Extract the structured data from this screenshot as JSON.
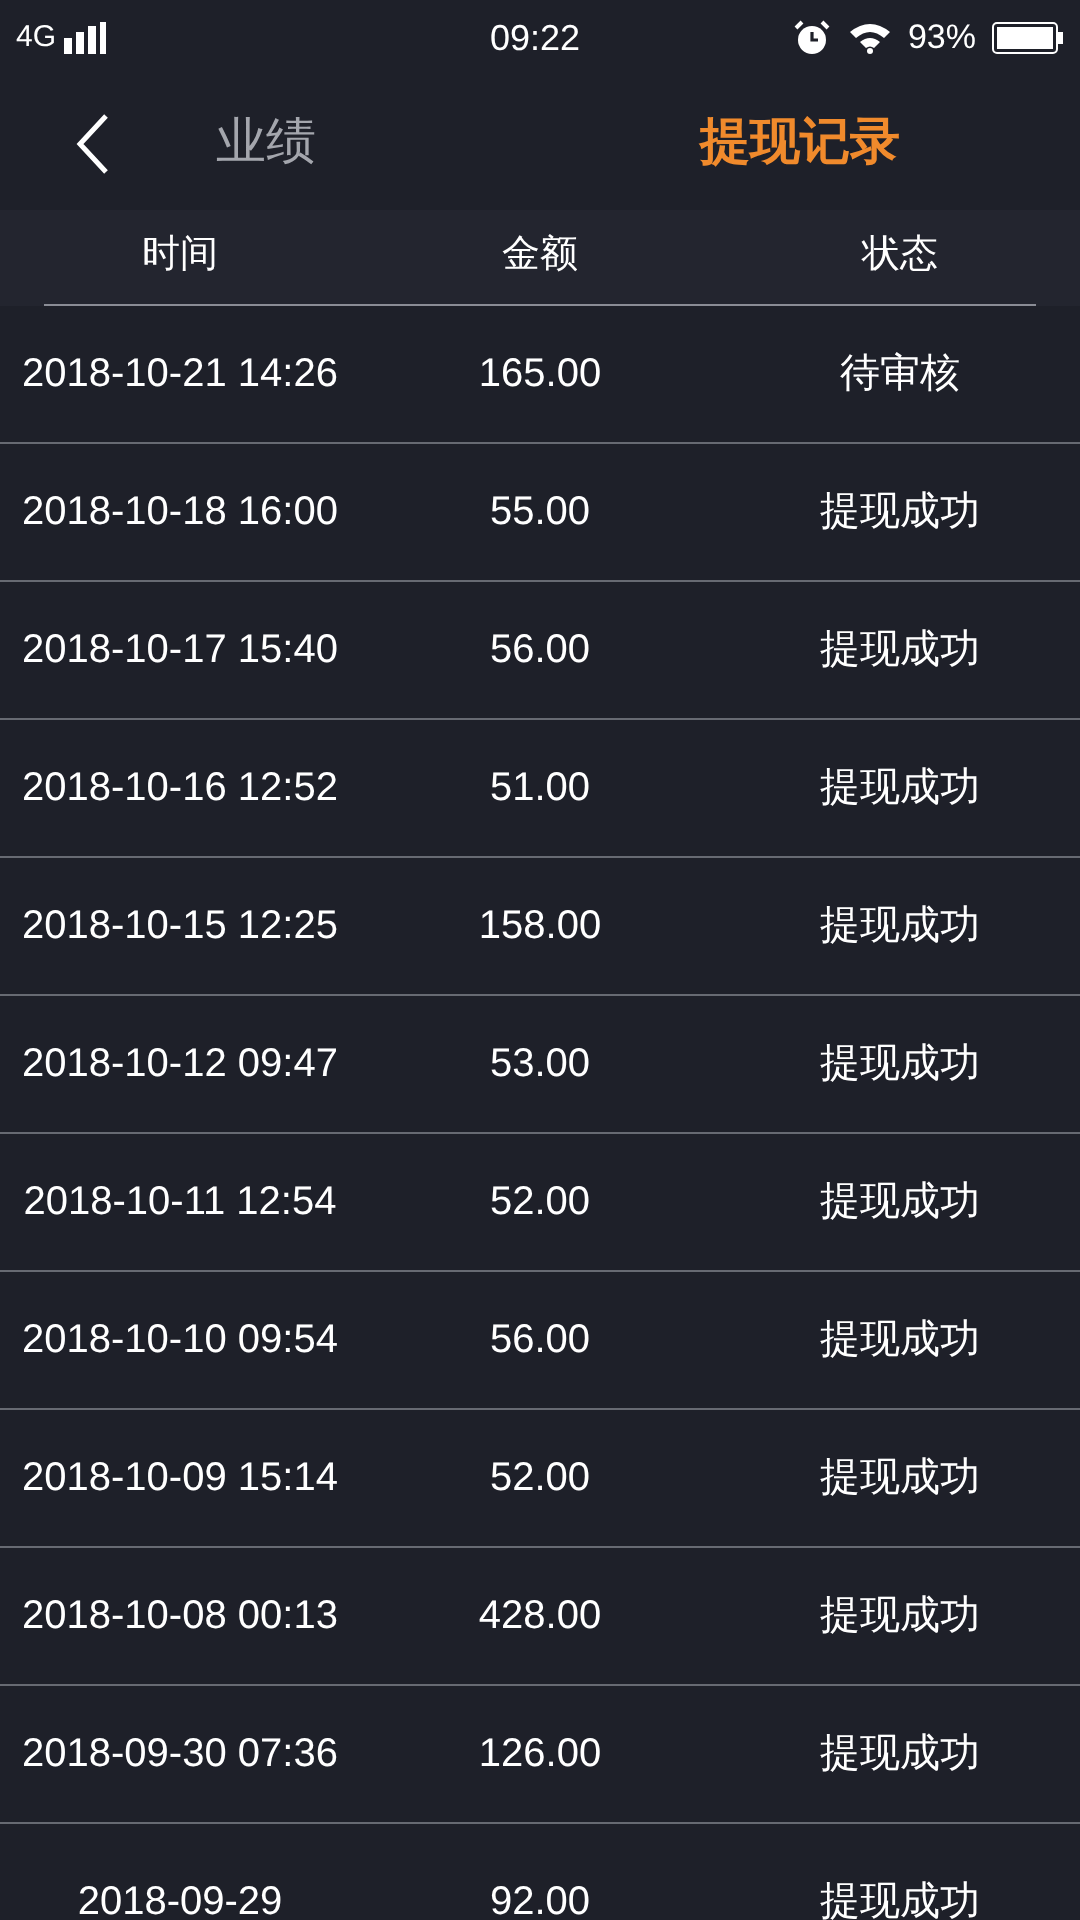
{
  "status_bar": {
    "network": "4G",
    "time": "09:22",
    "battery": "93%"
  },
  "nav": {
    "tabs": [
      {
        "label": "业绩",
        "selected": false
      },
      {
        "label": "提现记录",
        "selected": true
      }
    ]
  },
  "table": {
    "columns": [
      "时间",
      "金额",
      "状态"
    ],
    "rows": [
      {
        "time": "2018-10-21 14:26",
        "amount": "165.00",
        "status": "待审核"
      },
      {
        "time": "2018-10-18 16:00",
        "amount": "55.00",
        "status": "提现成功"
      },
      {
        "time": "2018-10-17 15:40",
        "amount": "56.00",
        "status": "提现成功"
      },
      {
        "time": "2018-10-16 12:52",
        "amount": "51.00",
        "status": "提现成功"
      },
      {
        "time": "2018-10-15 12:25",
        "amount": "158.00",
        "status": "提现成功"
      },
      {
        "time": "2018-10-12 09:47",
        "amount": "53.00",
        "status": "提现成功"
      },
      {
        "time": "2018-10-11 12:54",
        "amount": "52.00",
        "status": "提现成功"
      },
      {
        "time": "2018-10-10 09:54",
        "amount": "56.00",
        "status": "提现成功"
      },
      {
        "time": "2018-10-09 15:14",
        "amount": "52.00",
        "status": "提现成功"
      },
      {
        "time": "2018-10-08 00:13",
        "amount": "428.00",
        "status": "提现成功"
      },
      {
        "time": "2018-09-30 07:36",
        "amount": "126.00",
        "status": "提现成功"
      },
      {
        "time": "2018-09-29",
        "amount": "92.00",
        "status": "提现成功"
      }
    ]
  }
}
